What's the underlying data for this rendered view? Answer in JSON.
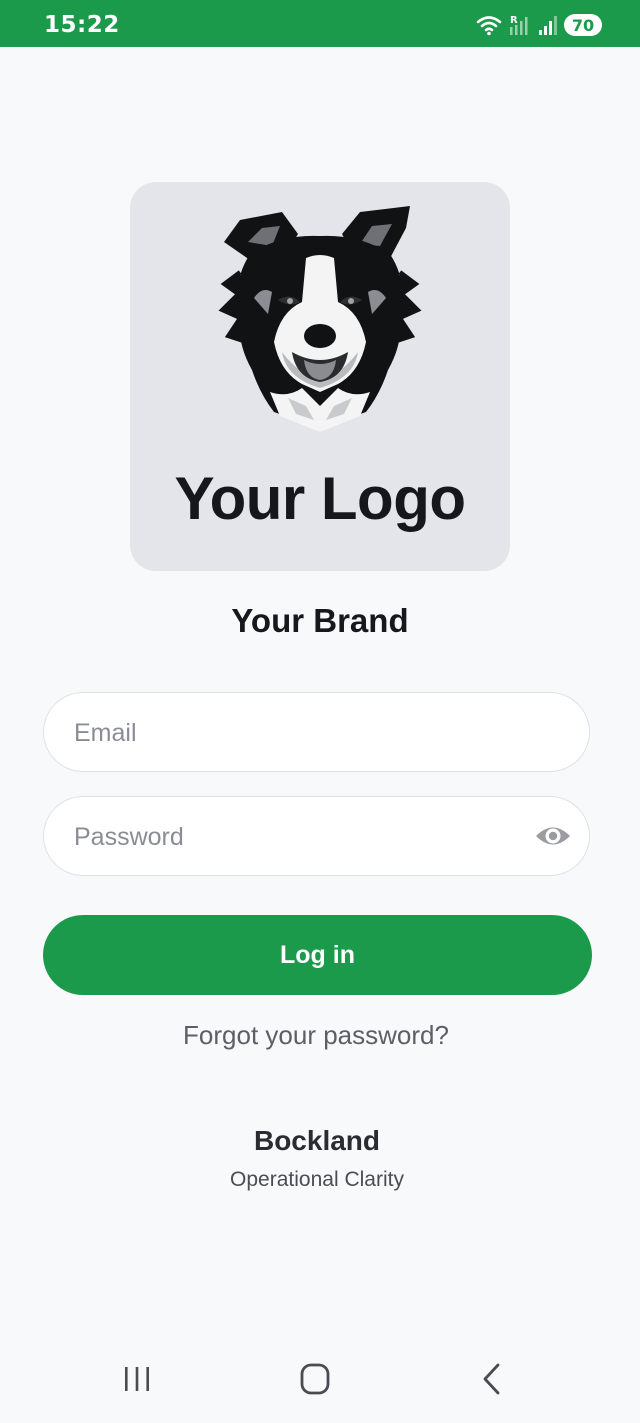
{
  "status_bar": {
    "time": "15:22",
    "battery": "70",
    "network_label": "R",
    "background": "#1b9a4b"
  },
  "logo": {
    "image": "border-collie-dog-logo",
    "text": "Your Logo"
  },
  "brand": {
    "name": "Your Brand"
  },
  "form": {
    "email_placeholder": "Email",
    "email_value": "",
    "password_placeholder": "Password",
    "password_value": "",
    "password_toggle_icon": "eye-icon",
    "login_label": "Log in",
    "forgot_label": "Forgot your password?"
  },
  "footer": {
    "company": "Bockland",
    "tagline": "Operational Clarity"
  },
  "nav": {
    "recent_icon": "recent-apps-icon",
    "home_icon": "home-icon",
    "back_icon": "back-icon"
  },
  "colors": {
    "accent": "#1b9a4b",
    "background": "#f8f9fb",
    "logo_card": "#e4e5ea"
  }
}
